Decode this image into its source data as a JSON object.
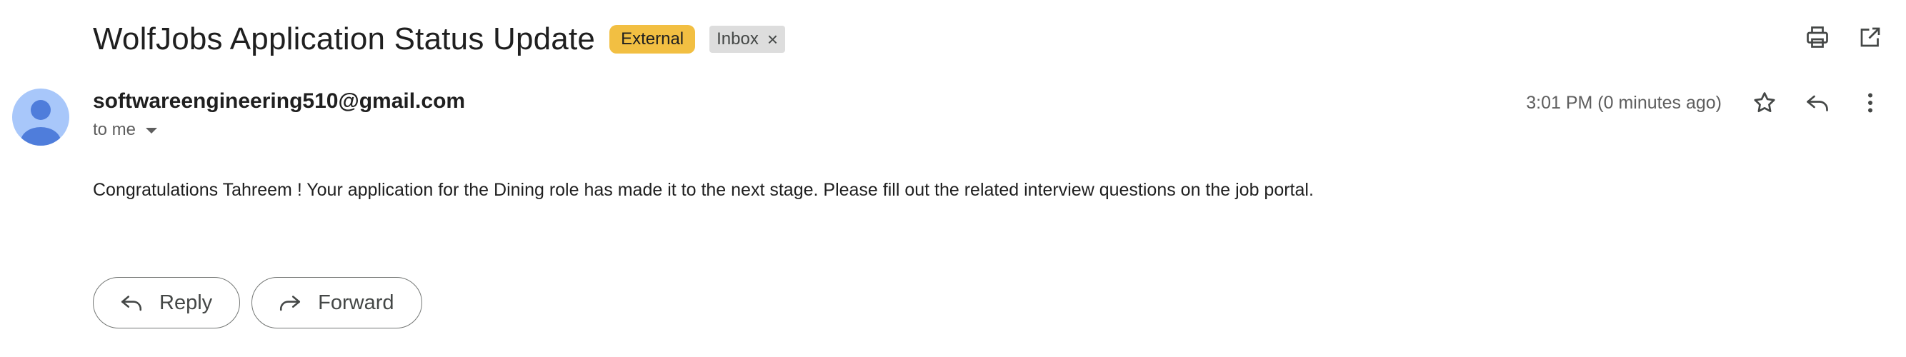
{
  "subject": "WolfJobs Application Status Update",
  "labels": {
    "external": "External",
    "inbox": "Inbox",
    "inbox_remove": "×"
  },
  "top_icons": [
    "print-icon",
    "open-in-new-window-icon"
  ],
  "sender": {
    "email": "softwareengineering510@gmail.com",
    "recipient": "to me"
  },
  "timestamp": "3:01 PM (0 minutes ago)",
  "header_icons": [
    "star-icon",
    "reply-icon",
    "more-vertical-icon"
  ],
  "body": "Congratulations Tahreem ! Your application for the Dining role has made it to the next stage. Please fill out the related interview questions on the job portal.",
  "actions": {
    "reply": "Reply",
    "forward": "Forward"
  },
  "colors": {
    "external_label": "#f2bf42",
    "inbox_label": "#dddddd",
    "avatar": "#a8c7fa",
    "avatar_figure": "#4f7ddb"
  }
}
